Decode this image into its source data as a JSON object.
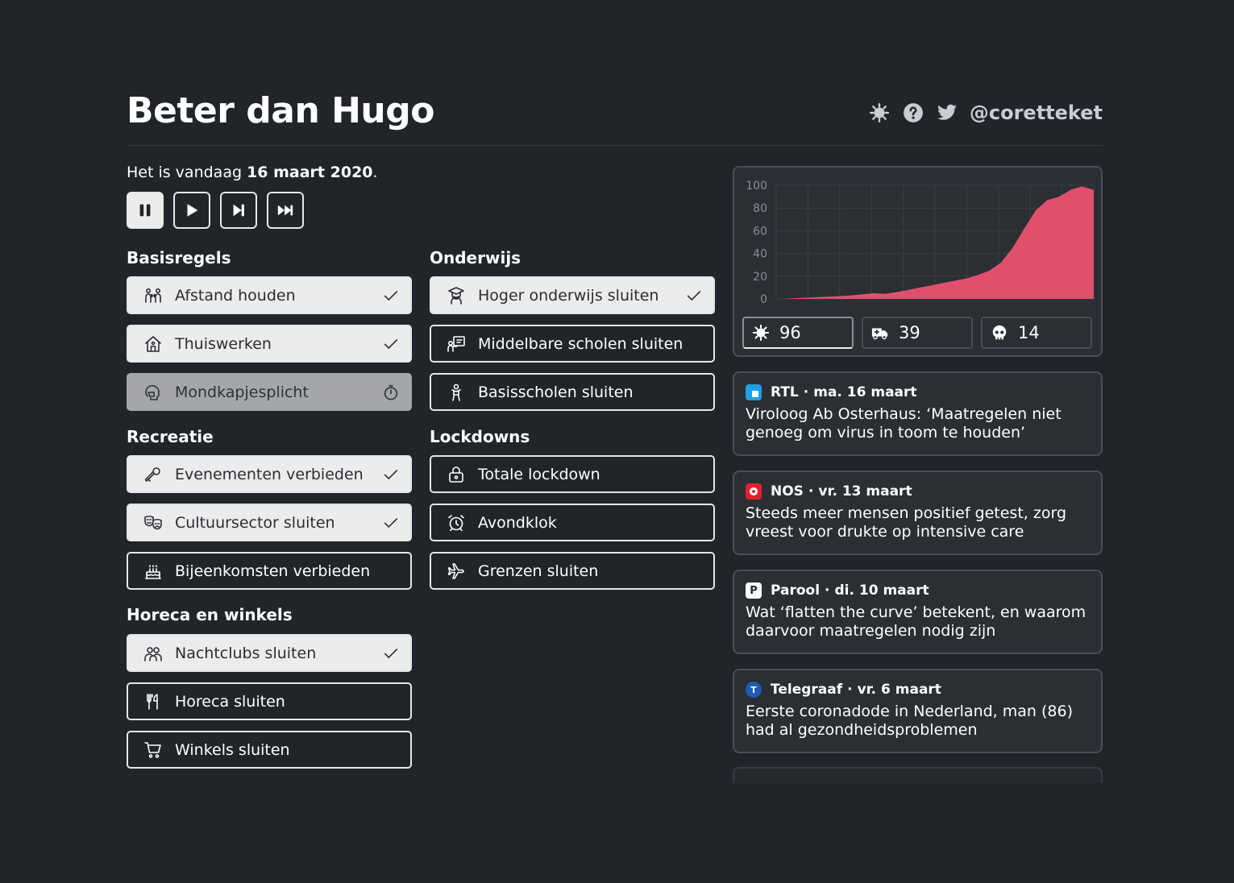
{
  "app": {
    "title": "Beter dan Hugo",
    "handle": "@coretteket"
  },
  "date": {
    "prefix": "Het is vandaag ",
    "value": "16 maart 2020",
    "suffix": "."
  },
  "controls": [
    {
      "name": "pause",
      "active": true
    },
    {
      "name": "play",
      "active": false
    },
    {
      "name": "step",
      "active": false
    },
    {
      "name": "fast-forward",
      "active": false
    }
  ],
  "sections": {
    "basisregels": {
      "title": "Basisregels",
      "items": [
        {
          "label": "Afstand houden",
          "icon": "people-distance-icon",
          "state": "on"
        },
        {
          "label": "Thuiswerken",
          "icon": "house-icon",
          "state": "on"
        },
        {
          "label": "Mondkapjesplicht",
          "icon": "head-mask-icon",
          "state": "pending"
        }
      ]
    },
    "recreatie": {
      "title": "Recreatie",
      "items": [
        {
          "label": "Evenementen verbieden",
          "icon": "microphone-icon",
          "state": "on"
        },
        {
          "label": "Cultuursector sluiten",
          "icon": "theater-masks-icon",
          "state": "on"
        },
        {
          "label": "Bijeenkomsten verbieden",
          "icon": "cake-icon",
          "state": "off"
        }
      ]
    },
    "horeca": {
      "title": "Horeca en winkels",
      "items": [
        {
          "label": "Nachtclubs sluiten",
          "icon": "people-group-icon",
          "state": "on"
        },
        {
          "label": "Horeca sluiten",
          "icon": "utensils-icon",
          "state": "off"
        },
        {
          "label": "Winkels sluiten",
          "icon": "cart-icon",
          "state": "off"
        }
      ]
    },
    "onderwijs": {
      "title": "Onderwijs",
      "items": [
        {
          "label": "Hoger onderwijs sluiten",
          "icon": "graduate-icon",
          "state": "on"
        },
        {
          "label": "Middelbare scholen sluiten",
          "icon": "teacher-board-icon",
          "state": "off"
        },
        {
          "label": "Basisscholen sluiten",
          "icon": "child-icon",
          "state": "off"
        }
      ]
    },
    "lockdowns": {
      "title": "Lockdowns",
      "items": [
        {
          "label": "Totale lockdown",
          "icon": "lock-icon",
          "state": "off"
        },
        {
          "label": "Avondklok",
          "icon": "alarm-clock-icon",
          "state": "off"
        },
        {
          "label": "Grenzen sluiten",
          "icon": "plane-icon",
          "state": "off"
        }
      ]
    }
  },
  "chart_data": {
    "type": "area",
    "title": "",
    "xlabel": "",
    "ylabel": "",
    "ylim": [
      0,
      100
    ],
    "yticks": [
      "100",
      "80",
      "60",
      "40",
      "20",
      "0"
    ],
    "grid": true,
    "color": "#e0506c",
    "values": [
      0,
      0.5,
      1,
      1.5,
      2,
      2.5,
      3,
      4,
      5,
      4.5,
      6,
      8,
      10,
      12,
      14,
      16,
      18,
      21,
      25,
      32,
      45,
      62,
      78,
      87,
      90,
      96,
      99,
      96
    ]
  },
  "stats": [
    {
      "icon": "virus-icon",
      "value": "96"
    },
    {
      "icon": "ambulance-icon",
      "value": "39"
    },
    {
      "icon": "skull-icon",
      "value": "14"
    }
  ],
  "news": [
    {
      "source": "RTL",
      "date": "ma. 16 maart",
      "headline": "Viroloog Ab Osterhaus: ‘Maatregelen niet genoeg om virus in toom te houden’",
      "logo_color": "#1ea0e6",
      "logo_text": ""
    },
    {
      "source": "NOS",
      "date": "vr. 13 maart",
      "headline": "Steeds meer mensen positief getest, zorg vreest voor drukte op intensive care",
      "logo_color": "#e4202e",
      "logo_text": ""
    },
    {
      "source": "Parool",
      "date": "di. 10 maart",
      "headline": "Wat ‘flatten the curve’ betekent, en waarom daarvoor maatregelen nodig zijn",
      "logo_color": "#ffffff",
      "logo_text": "P"
    },
    {
      "source": "Telegraaf",
      "date": "vr. 6 maart",
      "headline": "Eerste coronadode in Nederland, man (86) had al gezondheidsproblemen",
      "logo_color": "#1d5bb4",
      "logo_text": "T"
    }
  ]
}
